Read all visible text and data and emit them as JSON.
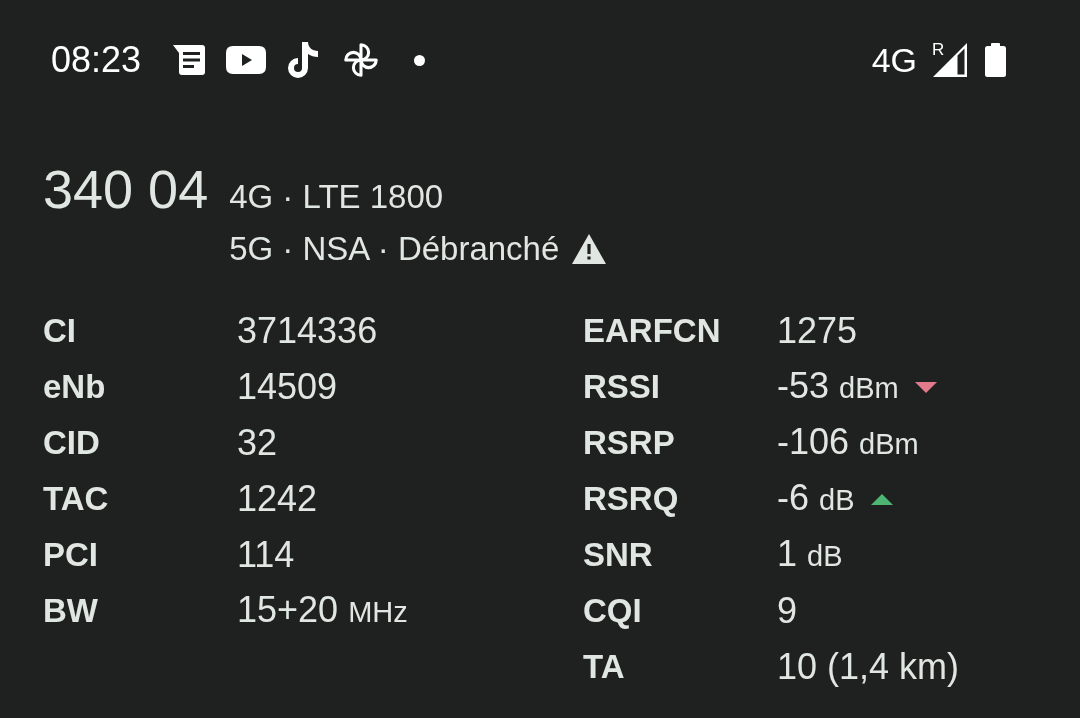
{
  "status_bar": {
    "time": "08:23",
    "network_type": "4G",
    "roaming_indicator": "R"
  },
  "network": {
    "operator_code": "340 04",
    "lines": [
      {
        "text": "4G · LTE 1800",
        "warning": false
      },
      {
        "text": "5G · NSA · Débranché",
        "warning": true
      }
    ]
  },
  "table": {
    "left": [
      {
        "label": "CI",
        "value": "3714336"
      },
      {
        "label": "eNb",
        "value": "14509"
      },
      {
        "label": "CID",
        "value": "32"
      },
      {
        "label": "TAC",
        "value": "1242"
      },
      {
        "label": "PCI",
        "value": "114"
      },
      {
        "label": "BW",
        "value": "15+20",
        "unit": "MHz"
      }
    ],
    "right": [
      {
        "kind": "plain",
        "label": "EARFCN",
        "value": "1275"
      },
      {
        "kind": "falling",
        "label": "RSSI",
        "value": "-53",
        "unit": "dBm"
      },
      {
        "kind": "plain",
        "label": "RSRP",
        "value": "-106",
        "unit": "dBm"
      },
      {
        "kind": "rising",
        "label": "RSRQ",
        "value": "-6",
        "unit": "dB"
      },
      {
        "kind": "plain",
        "label": "SNR",
        "value": "1",
        "unit": "dB"
      },
      {
        "kind": "plain",
        "label": "CQI",
        "value": "9"
      },
      {
        "kind": "plain",
        "label": "TA",
        "value": "10 (1,4 km)"
      }
    ]
  }
}
